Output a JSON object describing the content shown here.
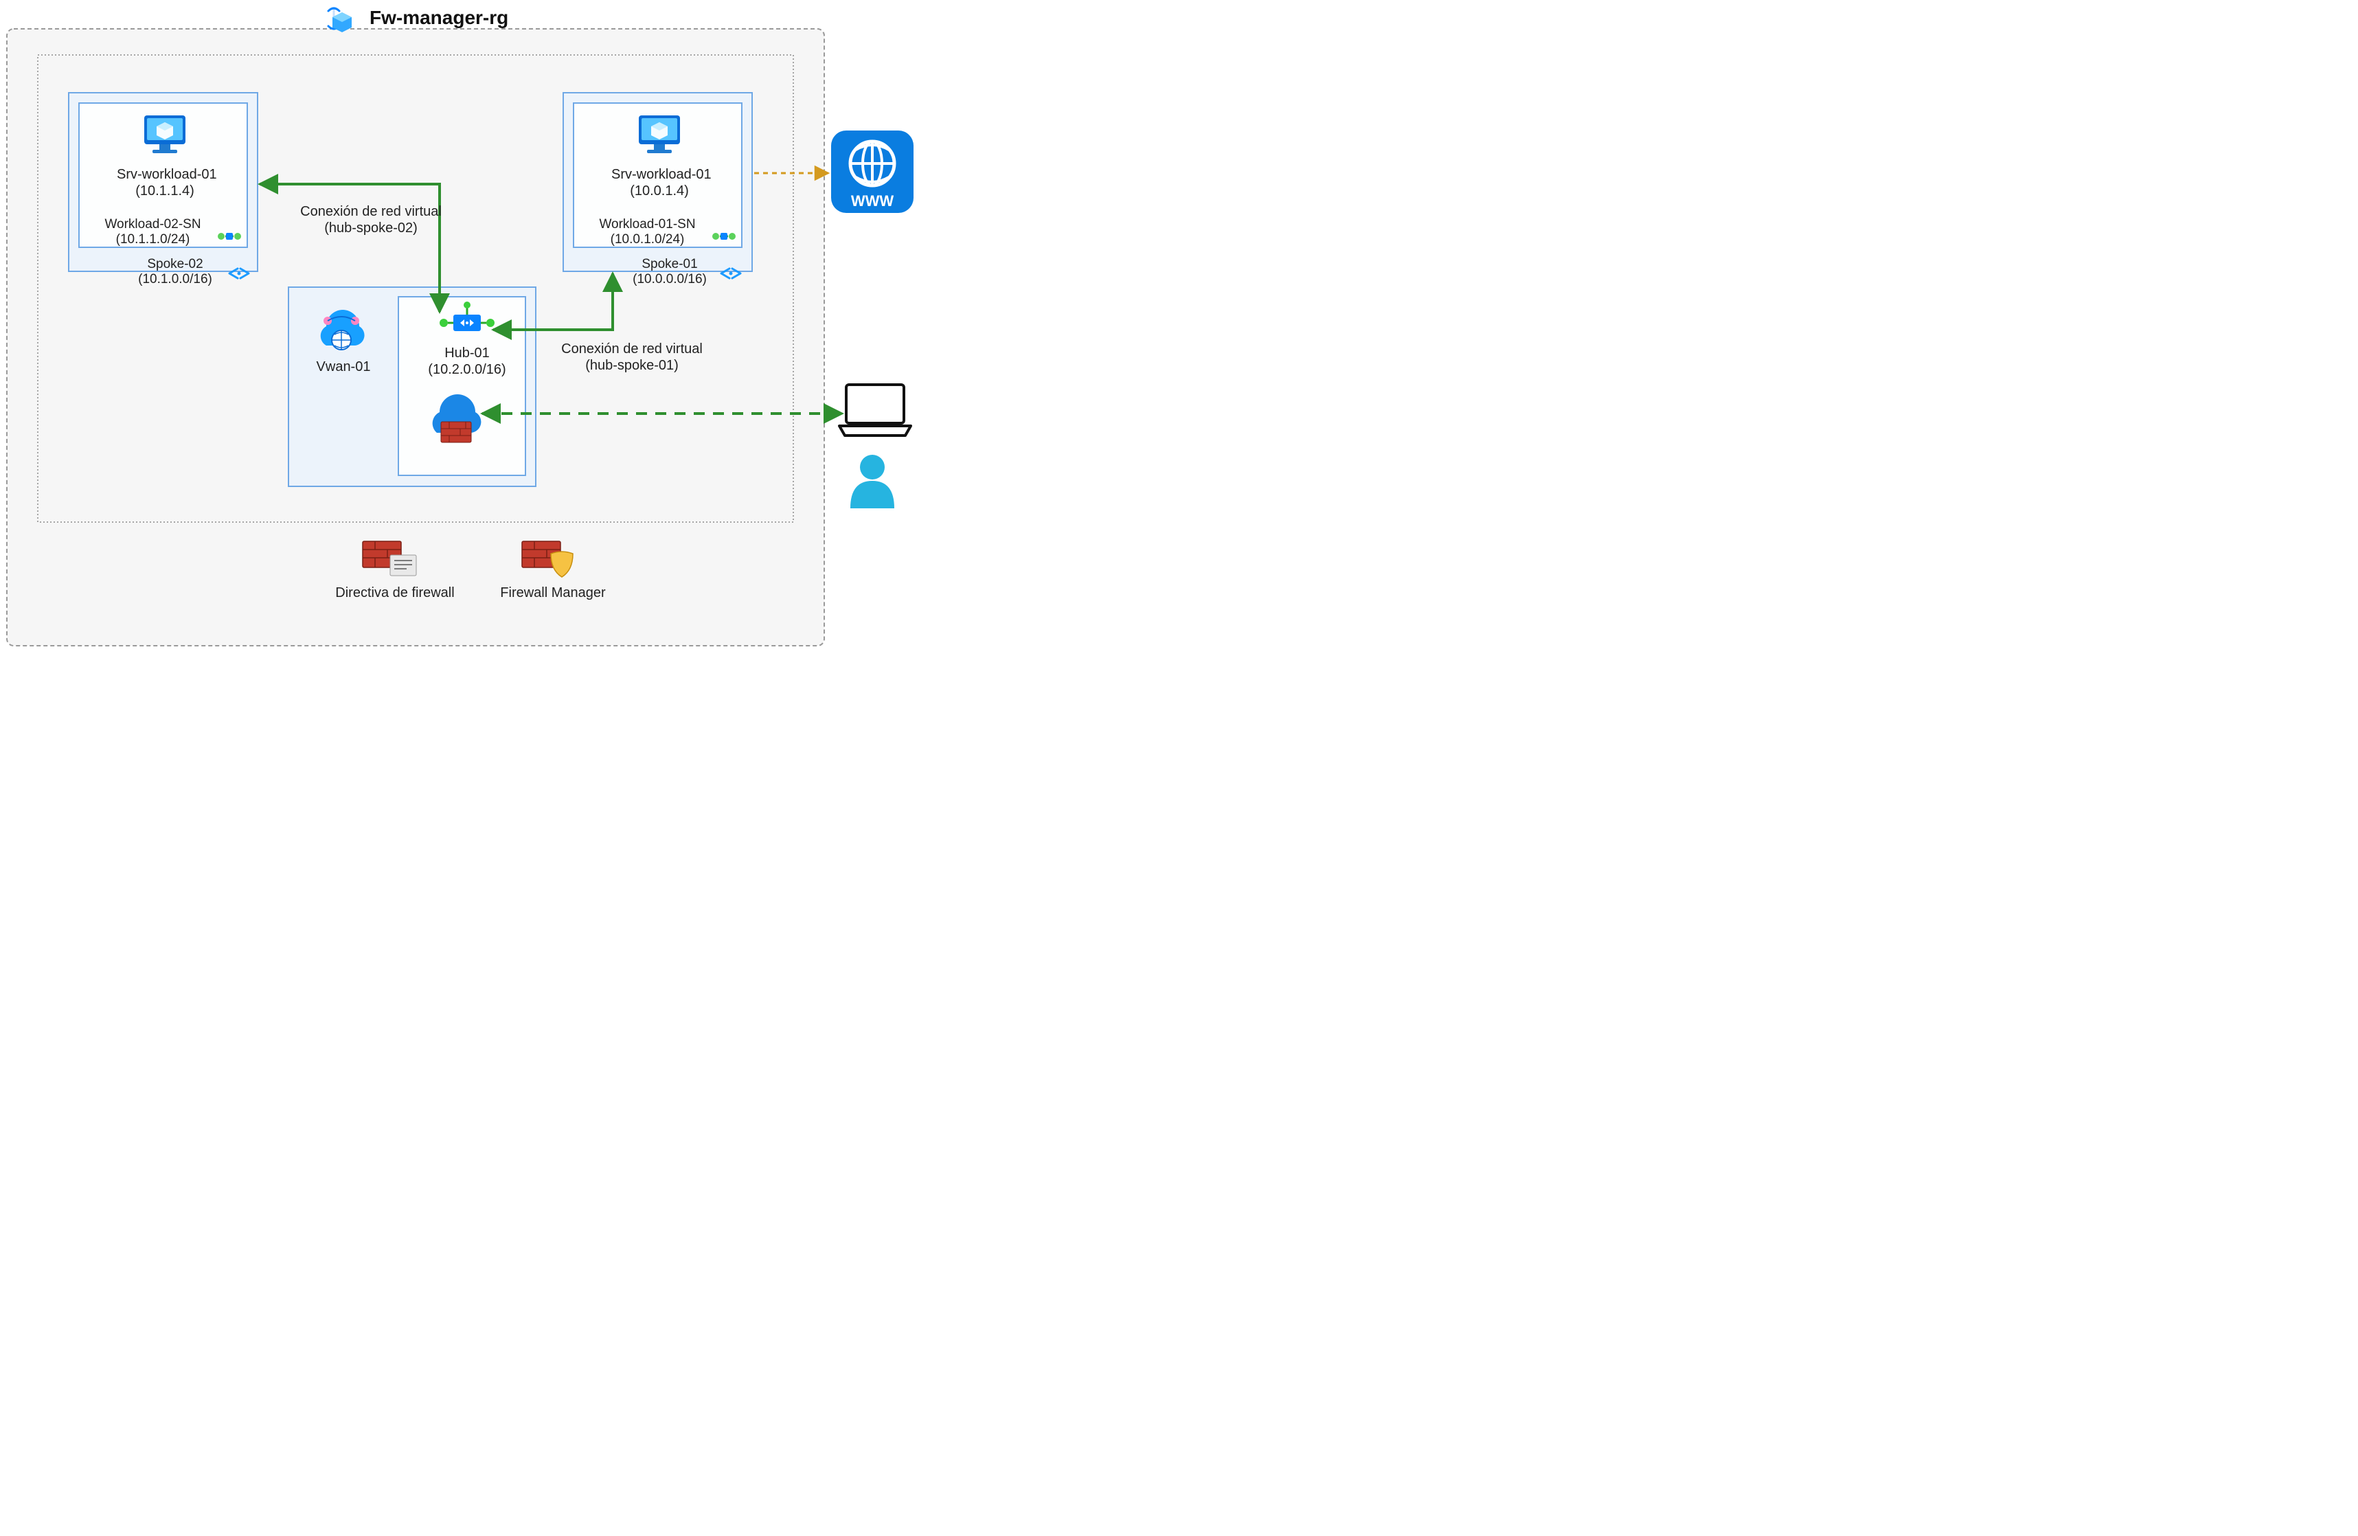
{
  "diagram": {
    "title": "Fw-manager-rg",
    "spoke02": {
      "vm_name": "Srv-workload-01",
      "vm_ip": "(10.1.1.4)",
      "subnet_name": "Workload-02-SN",
      "subnet_cidr": "(10.1.1.0/24)",
      "vnet_name": "Spoke-02",
      "vnet_cidr": "(10.1.0.0/16)"
    },
    "spoke01": {
      "vm_name": "Srv-workload-01",
      "vm_ip": "(10.0.1.4)",
      "subnet_name": "Workload-01-SN",
      "subnet_cidr": "(10.0.1.0/24)",
      "vnet_name": "Spoke-01",
      "vnet_cidr": "(10.0.0.0/16)"
    },
    "hub": {
      "vwan_name": "Vwan-01",
      "hub_name": "Hub-01",
      "hub_cidr": "(10.2.0.0/16)"
    },
    "conn02_line1": "Conexión de red virtual",
    "conn02_line2": "(hub-spoke-02)",
    "conn01_line1": "Conexión de red virtual",
    "conn01_line2": "(hub-spoke-01)",
    "legend": {
      "policy": "Directiva de firewall",
      "manager": "Firewall Manager"
    },
    "www_label": "WWW"
  }
}
